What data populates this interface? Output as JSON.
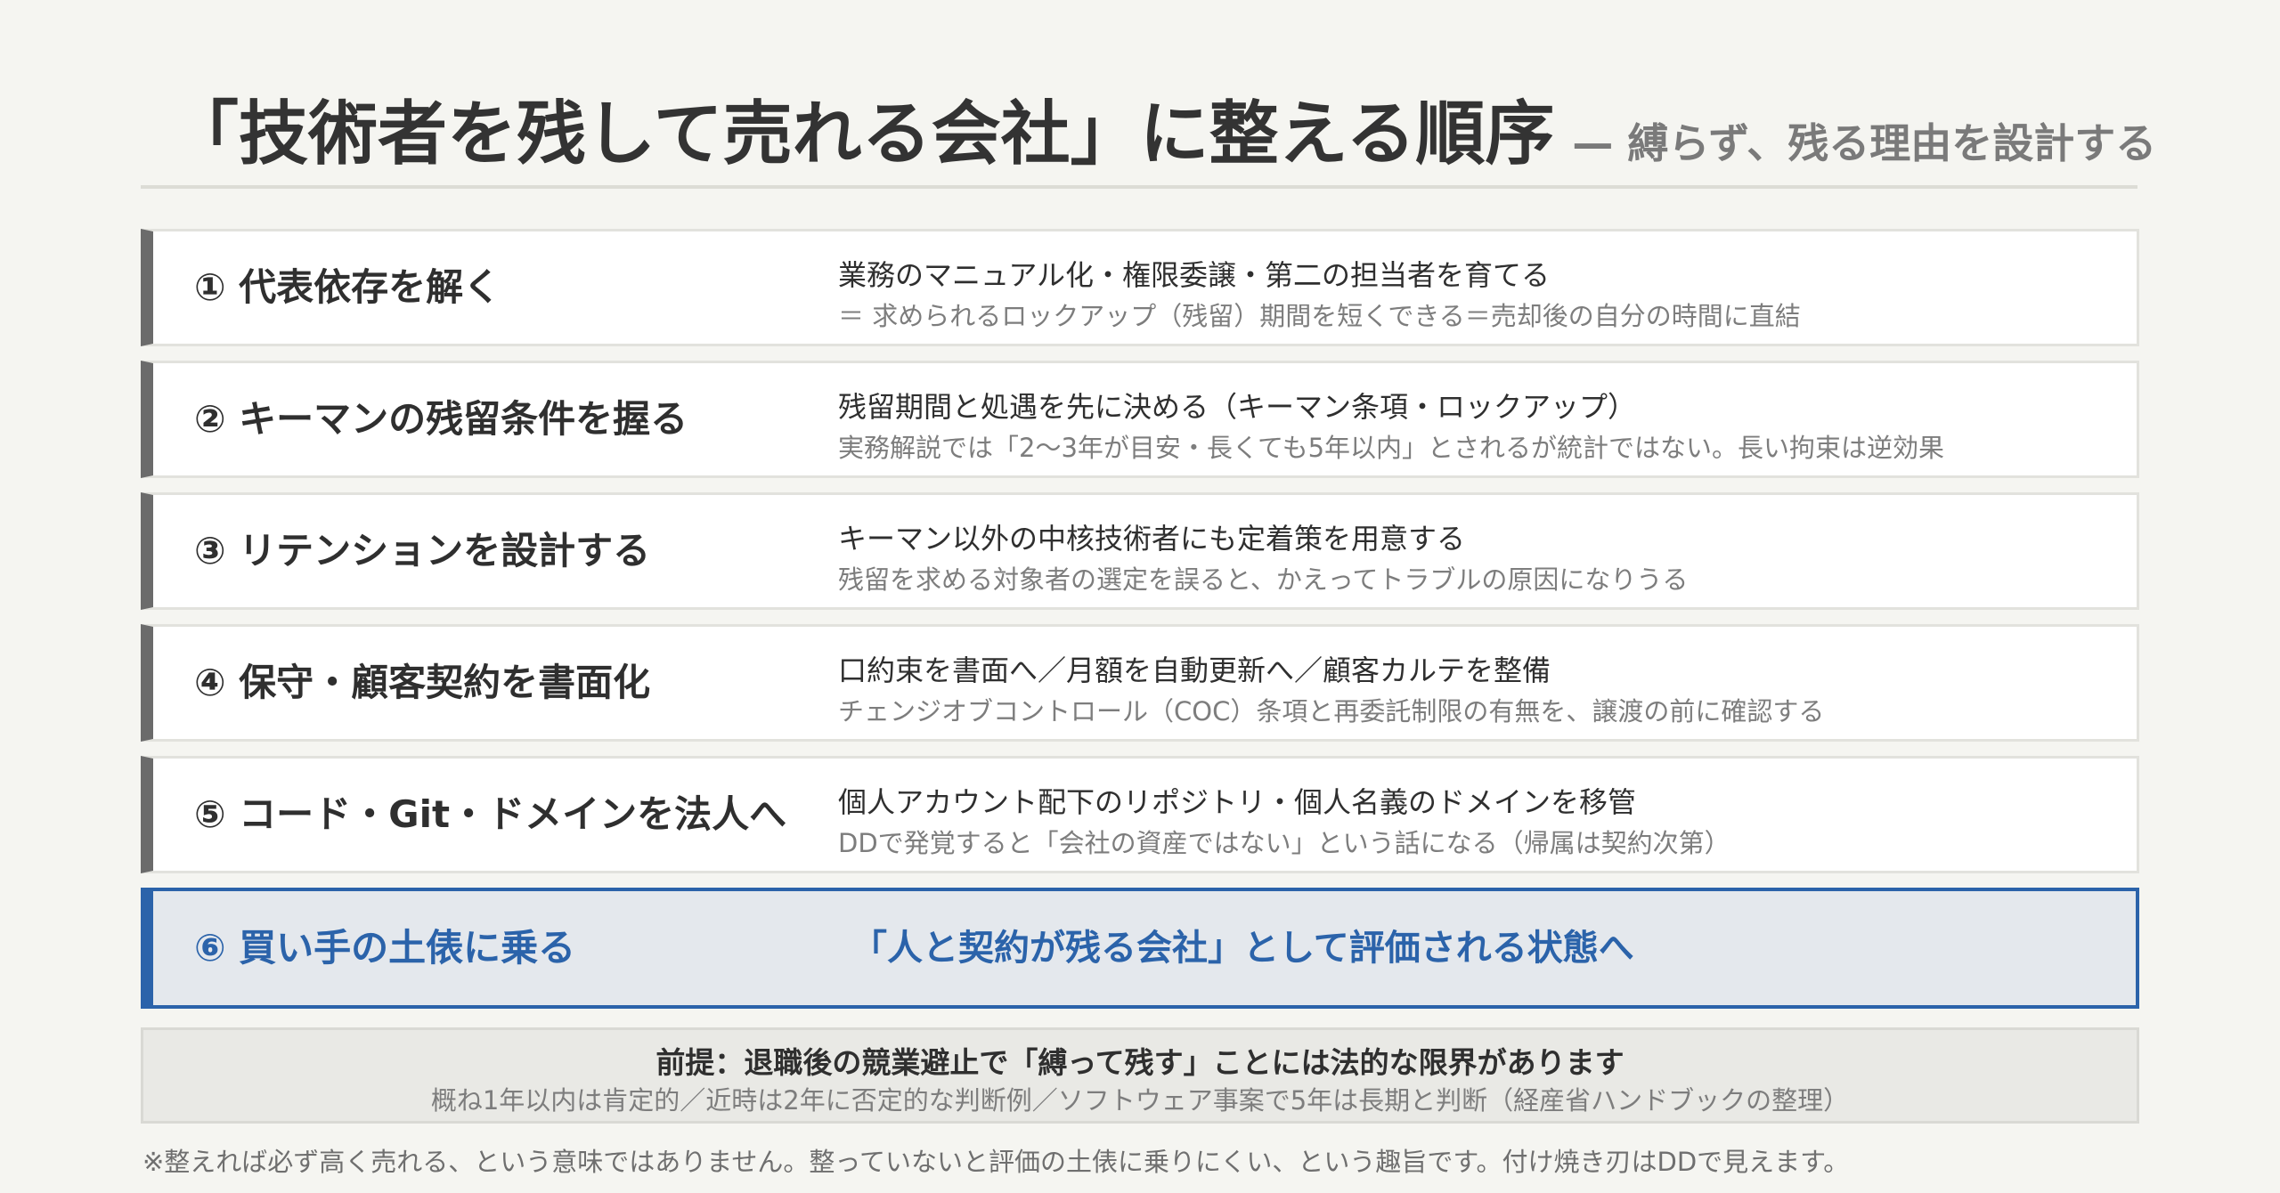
{
  "header": {
    "title": "「技術者を残して売れる会社」に整える順序",
    "subtitle": "— 縛らず、残る理由を設計する"
  },
  "steps": [
    {
      "title": "① 代表依存を解く",
      "main": "業務のマニュアル化・権限委譲・第二の担当者を育てる",
      "note": "＝ 求められるロックアップ（残留）期間を短くできる＝売却後の自分の時間に直結"
    },
    {
      "title": "② キーマンの残留条件を握る",
      "main": "残留期間と処遇を先に決める（キーマン条項・ロックアップ）",
      "note": "実務解説では「2〜3年が目安・長くても5年以内」とされるが統計ではない。長い拘束は逆効果"
    },
    {
      "title": "③ リテンションを設計する",
      "main": "キーマン以外の中核技術者にも定着策を用意する",
      "note": "残留を求める対象者の選定を誤ると、かえってトラブルの原因になりうる"
    },
    {
      "title": "④ 保守・顧客契約を書面化",
      "main": "口約束を書面へ／月額を自動更新へ／顧客カルテを整備",
      "note": "チェンジオブコントロール（COC）条項と再委託制限の有無を、譲渡の前に確認する"
    },
    {
      "title": "⑤ コード・Git・ドメインを法人へ",
      "main": "個人アカウント配下のリポジトリ・個人名義のドメインを移管",
      "note": "DDで発覚すると「会社の資産ではない」という話になる（帰属は契約次第）"
    }
  ],
  "final_step": {
    "title": "⑥ 買い手の土俵に乗る",
    "text": "「人と契約が残る会社」として評価される状態へ"
  },
  "premise": {
    "heading": "前提：退職後の競業避止で「縛って残す」ことには法的な限界があります",
    "body": "概ね1年以内は肯定的／近時は2年に否定的な判断例／ソフトウェア事案で5年は長期と判断（経産省ハンドブックの整理）"
  },
  "footnote": "※整えれば必ず高く売れる、という意味ではありません。整っていないと評価の土俵に乗りにくい、という趣旨です。付け焼き刃はDDで見えます。",
  "colors": {
    "accent": "#2b63aa",
    "step_bar": "#6b6b6b",
    "background": "#f5f5f1"
  }
}
